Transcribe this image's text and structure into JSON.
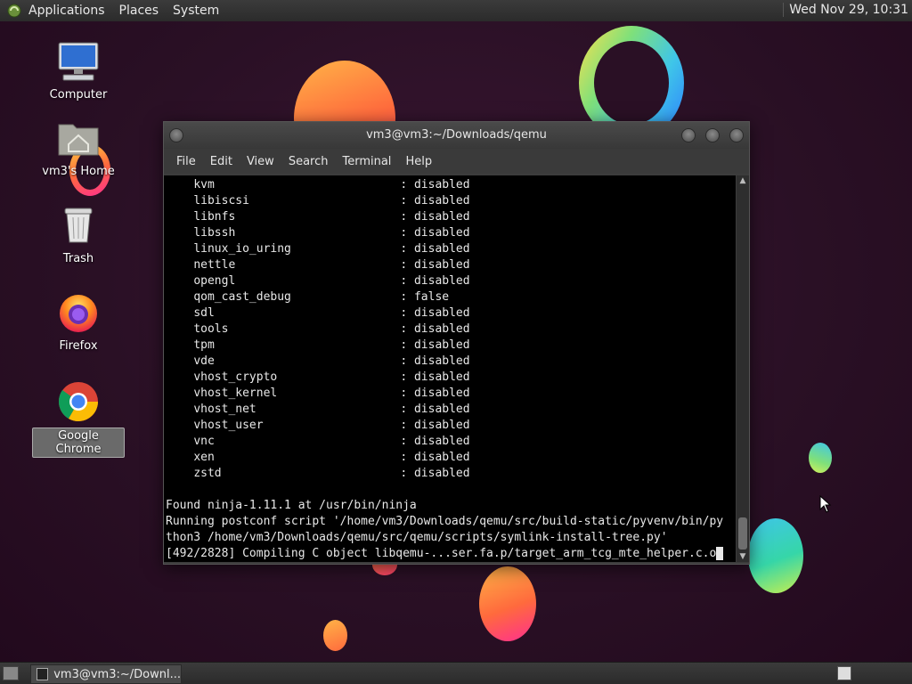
{
  "top_panel": {
    "menus": [
      "Applications",
      "Places",
      "System"
    ],
    "clock": "Wed Nov 29, 10:31"
  },
  "desktop_icons": [
    {
      "label": "Computer",
      "icon": "computer-icon"
    },
    {
      "label": "vm3's Home",
      "icon": "home-folder-icon"
    },
    {
      "label": "Trash",
      "icon": "trash-icon"
    },
    {
      "label": "Firefox",
      "icon": "firefox-icon"
    },
    {
      "label": "Google Chrome",
      "icon": "chrome-icon",
      "selected": true
    }
  ],
  "terminal": {
    "title": "vm3@vm3:~/Downloads/qemu",
    "menus": [
      "File",
      "Edit",
      "View",
      "Search",
      "Terminal",
      "Help"
    ],
    "options": [
      {
        "name": "kvm",
        "value": "disabled"
      },
      {
        "name": "libiscsi",
        "value": "disabled"
      },
      {
        "name": "libnfs",
        "value": "disabled"
      },
      {
        "name": "libssh",
        "value": "disabled"
      },
      {
        "name": "linux_io_uring",
        "value": "disabled"
      },
      {
        "name": "nettle",
        "value": "disabled"
      },
      {
        "name": "opengl",
        "value": "disabled"
      },
      {
        "name": "qom_cast_debug",
        "value": "false"
      },
      {
        "name": "sdl",
        "value": "disabled"
      },
      {
        "name": "tools",
        "value": "disabled"
      },
      {
        "name": "tpm",
        "value": "disabled"
      },
      {
        "name": "vde",
        "value": "disabled"
      },
      {
        "name": "vhost_crypto",
        "value": "disabled"
      },
      {
        "name": "vhost_kernel",
        "value": "disabled"
      },
      {
        "name": "vhost_net",
        "value": "disabled"
      },
      {
        "name": "vhost_user",
        "value": "disabled"
      },
      {
        "name": "vnc",
        "value": "disabled"
      },
      {
        "name": "xen",
        "value": "disabled"
      },
      {
        "name": "zstd",
        "value": "disabled"
      }
    ],
    "trailing_lines": [
      "",
      "Found ninja-1.11.1 at /usr/bin/ninja",
      "Running postconf script '/home/vm3/Downloads/qemu/src/build-static/pyvenv/bin/py",
      "thon3 /home/vm3/Downloads/qemu/src/qemu/scripts/symlink-install-tree.py'"
    ],
    "last_line": "[492/2828] Compiling C object libqemu-...ser.fa.p/target_arm_tcg_mte_helper.c.o"
  },
  "taskbar": {
    "task_label": "vm3@vm3:~/Downl..."
  },
  "colors": {
    "panel": "#2e2e2e",
    "terminal_bg": "#000000",
    "terminal_fg": "#e8e8e8",
    "desktop_bg": "#2a1025"
  }
}
